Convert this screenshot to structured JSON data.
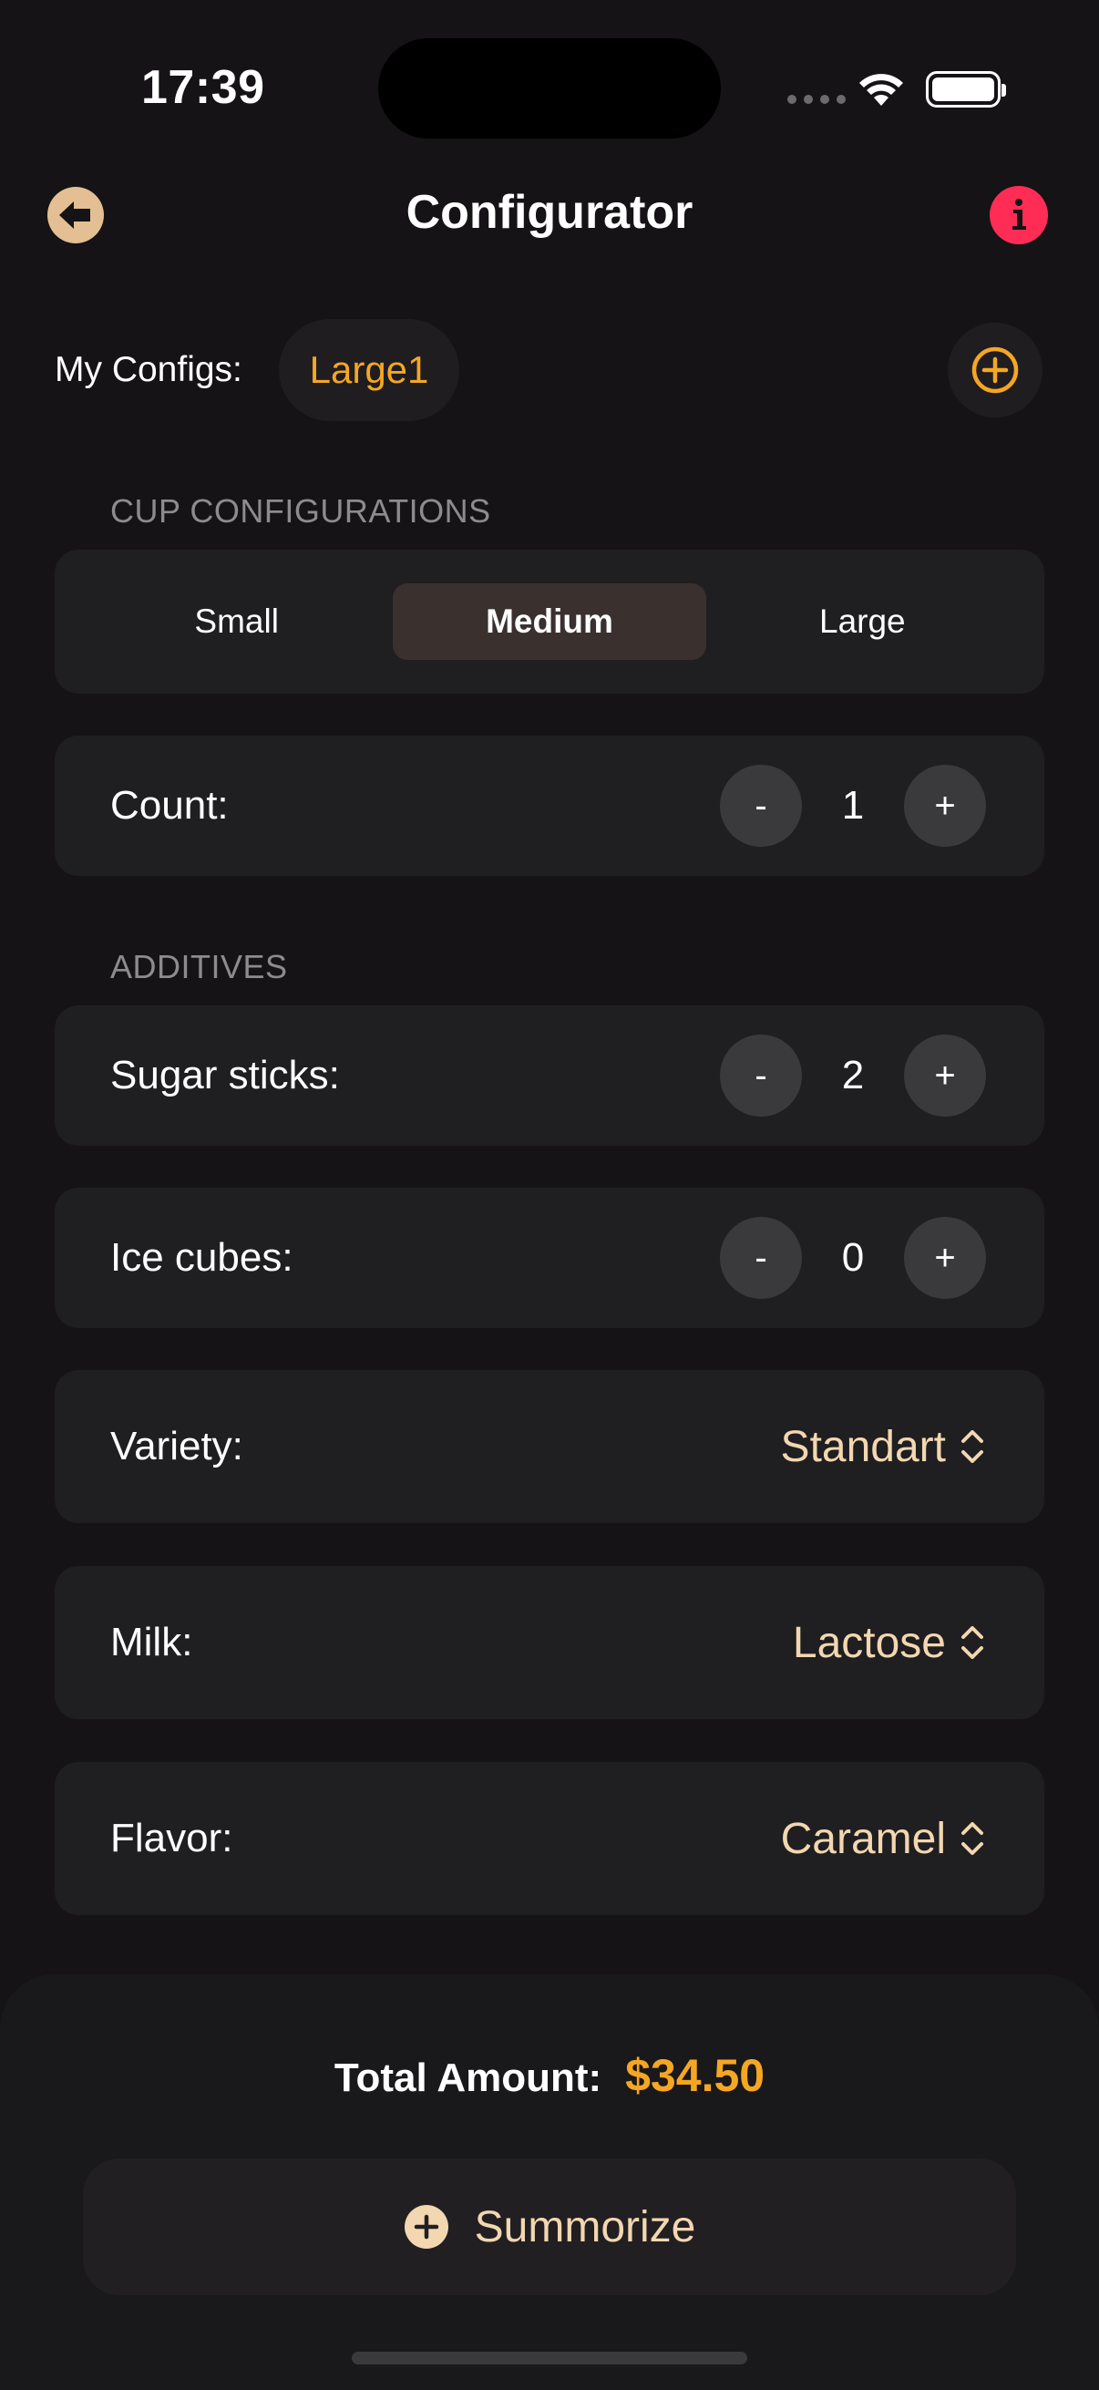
{
  "status_bar": {
    "time": "17:39"
  },
  "nav": {
    "title": "Configurator"
  },
  "configs": {
    "label": "My Configs:",
    "active": "Large1"
  },
  "cup_section": {
    "header": "CUP CONFIGURATIONS",
    "options": [
      "Small",
      "Medium",
      "Large"
    ],
    "selected": "Medium"
  },
  "count": {
    "label": "Count:",
    "value": "1",
    "minus": "-",
    "plus": "+"
  },
  "additives": {
    "header": "ADDITIVES",
    "sugar": {
      "label": "Sugar sticks:",
      "value": "2",
      "minus": "-",
      "plus": "+"
    },
    "ice": {
      "label": "Ice cubes:",
      "value": "0",
      "minus": "-",
      "plus": "+"
    }
  },
  "variety": {
    "label": "Variety:",
    "value": "Standart"
  },
  "milk": {
    "label": "Milk:",
    "value": "Lactose"
  },
  "flavor": {
    "label": "Flavor:",
    "value": "Caramel"
  },
  "summary": {
    "total_label": "Total Amount:",
    "total_value": "$34.50",
    "button_label": "Summorize"
  },
  "colors": {
    "accent": "#f5a623",
    "info": "#ff2d55",
    "back": "#e3bf93",
    "picker": "#f2d7b0"
  }
}
